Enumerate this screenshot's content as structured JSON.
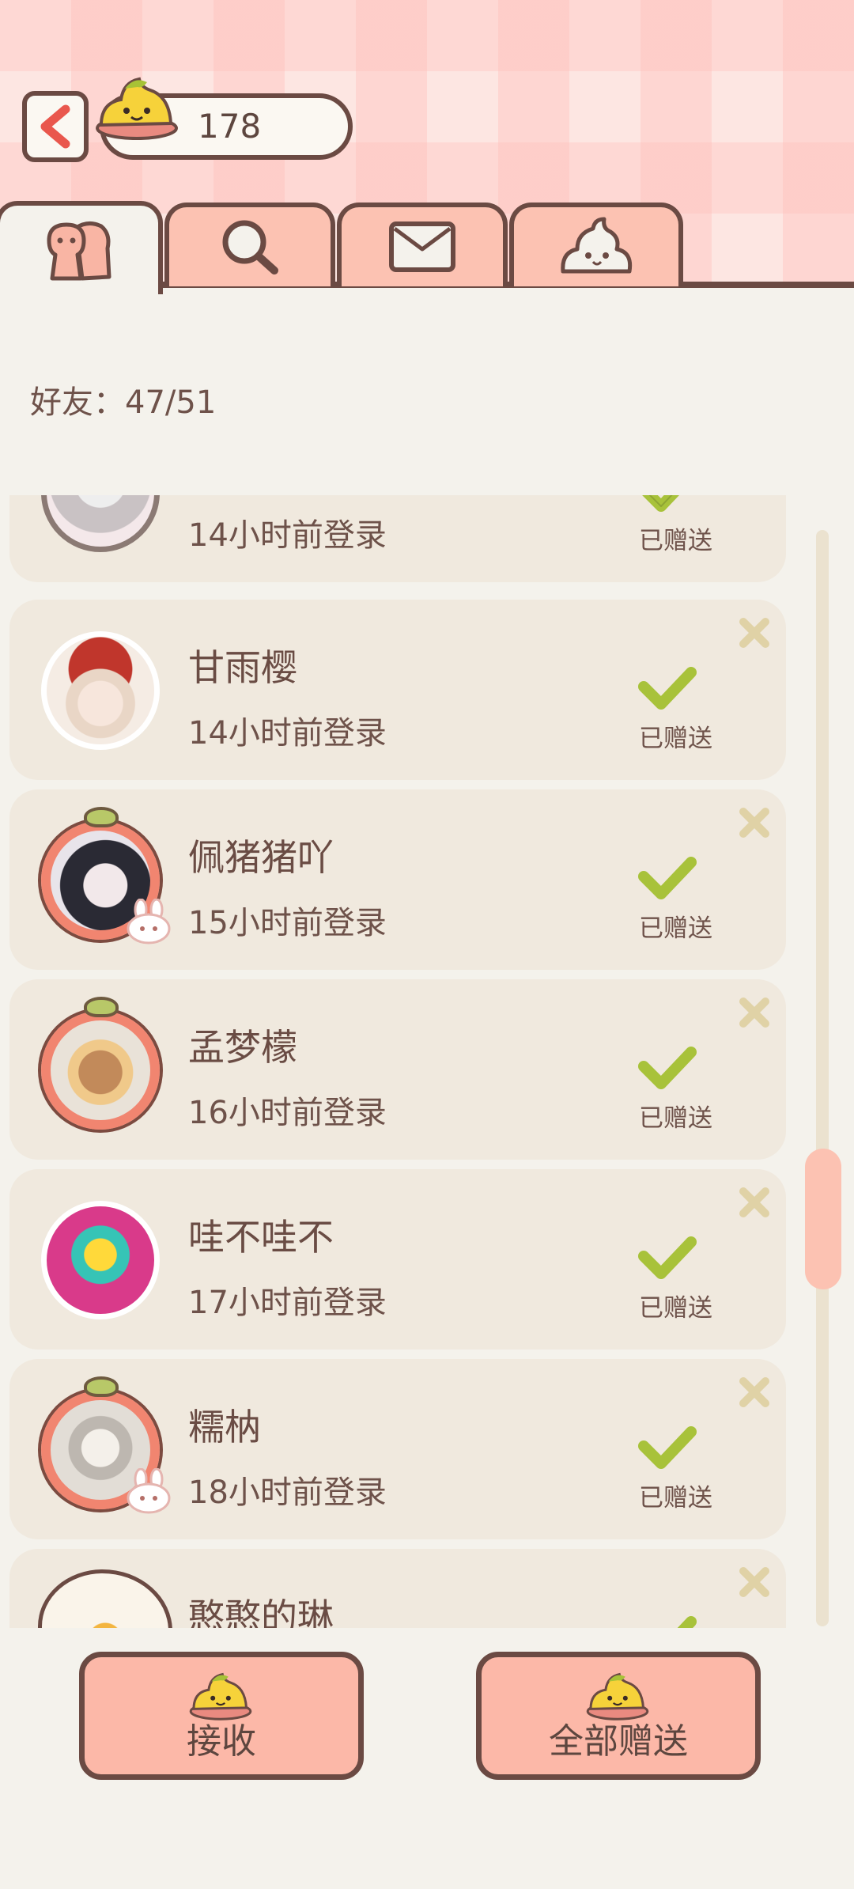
{
  "header": {
    "coin_count": "178"
  },
  "tabs": [
    {
      "icon": "friends-icon",
      "active": true
    },
    {
      "icon": "search-icon",
      "active": false
    },
    {
      "icon": "mail-icon",
      "active": false
    },
    {
      "icon": "poop-icon",
      "active": false
    }
  ],
  "friends_label": "好友：47/51",
  "sent_label": "已赠送",
  "friends": [
    {
      "name": "",
      "login": "14小时前登录",
      "avatar": "partial-avatar"
    },
    {
      "name": "甘雨樱",
      "login": "14小时前登录",
      "avatar": "girl-red-hat"
    },
    {
      "name": "佩猪猪吖",
      "login": "15小时前登录",
      "avatar": "fruit-frame-girl"
    },
    {
      "name": "孟梦檬",
      "login": "16小时前登录",
      "avatar": "fruit-frame-bear"
    },
    {
      "name": "哇不哇不",
      "login": "17小时前登录",
      "avatar": "pink-cartoon"
    },
    {
      "name": "糯枘",
      "login": "18小时前登录",
      "avatar": "fruit-frame-white-hair"
    },
    {
      "name": "憨憨的琳",
      "login": "",
      "avatar": "bread-cartoon"
    }
  ],
  "buttons": {
    "receive_label": "接收",
    "send_all_label": "全部赠送"
  },
  "colors": {
    "accent_pink": "#fcc2b2",
    "border_brown": "#6b4a43",
    "check_green": "#a8c23a",
    "card_bg": "#f0e9de",
    "page_bg": "#f4f2ec"
  }
}
